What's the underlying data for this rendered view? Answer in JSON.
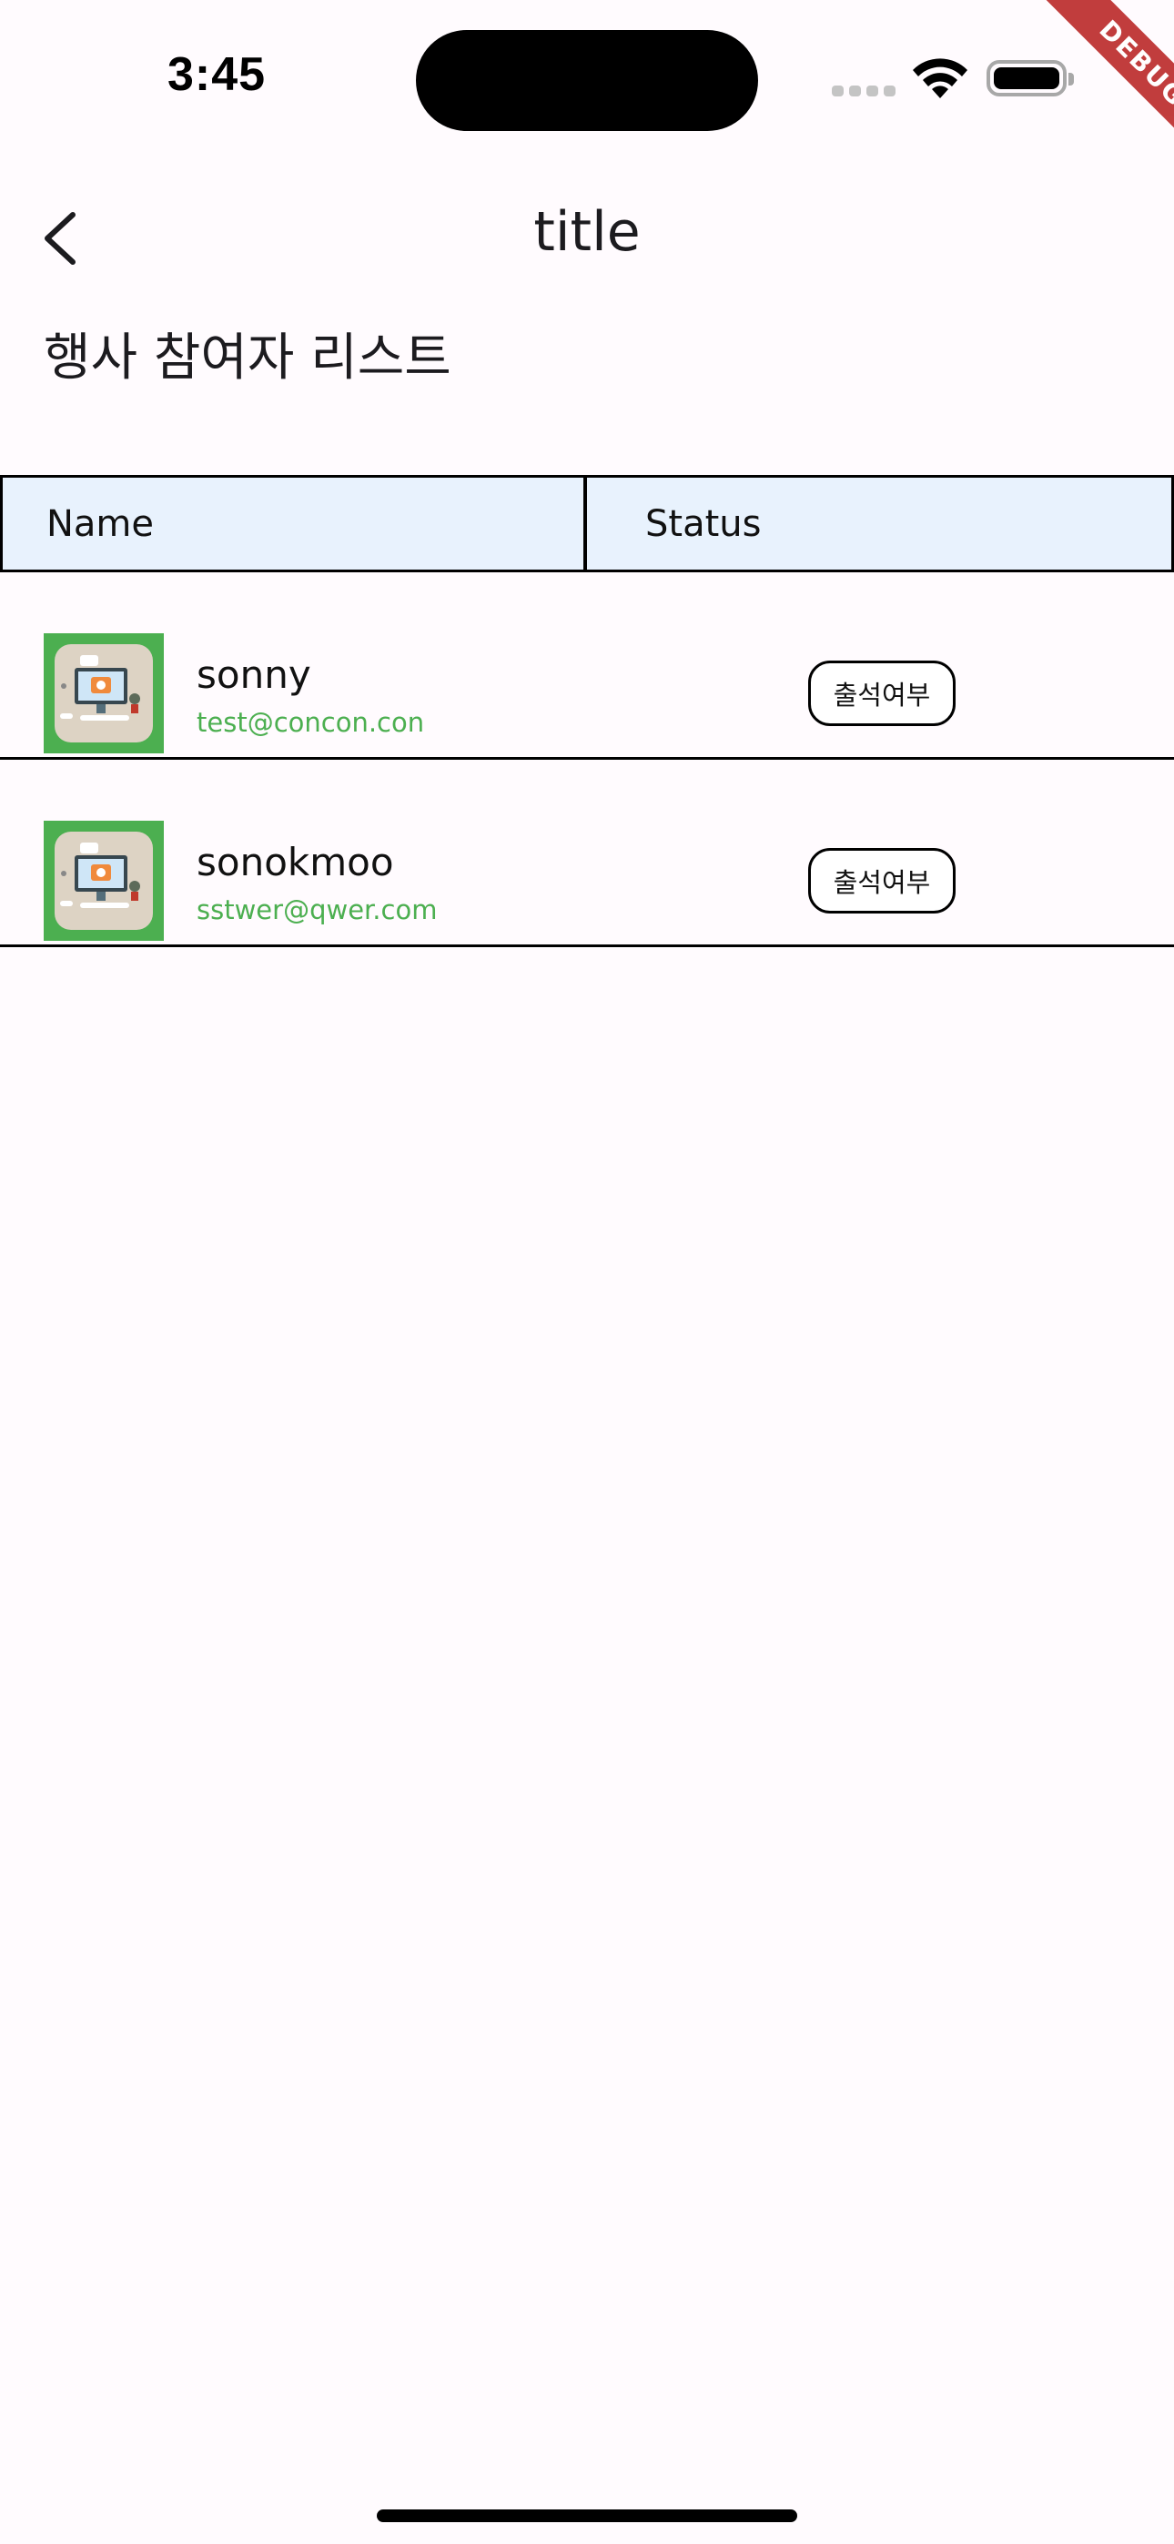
{
  "status_bar": {
    "time": "3:45"
  },
  "debug_banner": "DEBUG",
  "app_bar": {
    "title": "title",
    "back_icon": "chevron-left-icon"
  },
  "section_heading": "행사 참여자 리스트",
  "table": {
    "columns": [
      "Name",
      "Status"
    ],
    "rows": [
      {
        "name": "sonny",
        "email": "test@concon.con",
        "button_label": "출석여부"
      },
      {
        "name": "sonokmoo",
        "email": "sstwer@qwer.com",
        "button_label": "출석여부"
      }
    ]
  },
  "colors": {
    "background": "#fffbfe",
    "header_bg": "#e8f2fd",
    "email_green": "#4caf50",
    "avatar_green": "#4caf50",
    "debug_red": "#b71c1c"
  }
}
